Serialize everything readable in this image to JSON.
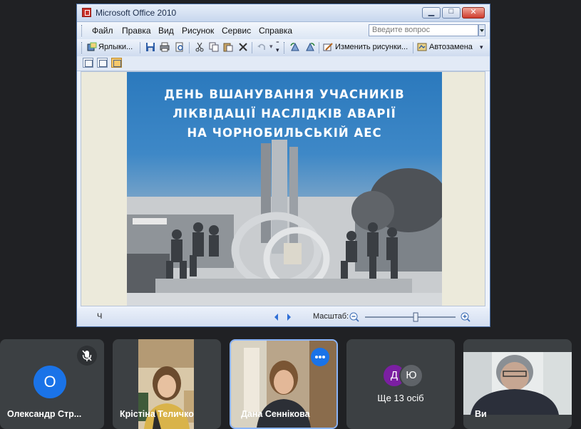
{
  "window": {
    "title": "Microsoft Office 2010",
    "minimize_icon": "minimize-icon",
    "maximize_icon": "maximize-icon",
    "close_icon": "close-icon"
  },
  "menubar": {
    "items": [
      "Файл",
      "Правка",
      "Вид",
      "Рисунок",
      "Сервис",
      "Справка"
    ],
    "question_placeholder": "Введите вопрос"
  },
  "toolbar": {
    "shortcuts_label": "Ярлыки...",
    "edit_pictures_label": "Изменить рисунки...",
    "autocorrect_label": "Автозамена"
  },
  "slide": {
    "title_lines": [
      "ДЕНЬ ВШАНУВАННЯ УЧАСНИКІВ",
      "ЛІКВІДАЦІЇ НАСЛІДКІВ АВАРІЇ",
      "НА ЧОРНОБИЛЬСЬКІЙ АЕС"
    ]
  },
  "statusbar": {
    "left_text": "Ч",
    "zoom_label": "Масштаб:",
    "zoom_level": 0.56
  },
  "participants": [
    {
      "name": "Олександр Стр...",
      "avatar_letter": "О",
      "avatar_color": "#1a73e8",
      "muted": true
    },
    {
      "name": "Крістіна Теличко"
    },
    {
      "name": "Дана Сеннікова",
      "highlighted": true
    },
    {
      "name": "Ще 13 осіб",
      "avatar_letters": [
        "Д",
        "Ю"
      ],
      "avatar_colors": [
        "#7b1fa2",
        "#5f6368"
      ]
    },
    {
      "name": "Ви"
    }
  ]
}
